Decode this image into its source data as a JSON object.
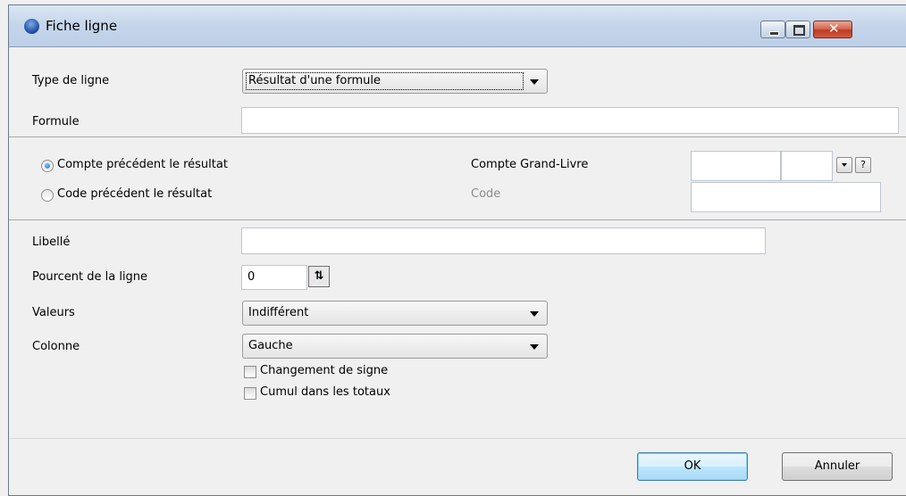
{
  "window": {
    "title": "Fiche ligne",
    "icon": "app-globe-icon"
  },
  "form": {
    "type_ligne_label": "Type de ligne",
    "type_ligne_value": "Résultat d'une formule",
    "formule_label": "Formule",
    "formule_value": "",
    "libelle_label": "Libellé",
    "libelle_value": "",
    "pourcent_label": "Pourcent de la ligne",
    "pourcent_value": "0",
    "valeurs_label": "Valeurs",
    "valeurs_value": "Indifférent",
    "colonne_label": "Colonne",
    "colonne_value": "Gauche",
    "changement_signe_label": "Changement de signe",
    "changement_signe_checked": false,
    "cumul_totaux_label": "Cumul dans les totaux",
    "cumul_totaux_checked": false
  },
  "group": {
    "radio_compte_label": "Compte précédent le résultat",
    "radio_compte_selected": true,
    "radio_code_label": "Code précédent le résultat",
    "radio_code_selected": false,
    "compte_gl_label": "Compte Grand-Livre",
    "compte_gl_value": "",
    "compte_gl_value2": "",
    "code_label": "Code",
    "code_value": "",
    "help_button_label": "?"
  },
  "buttons": {
    "ok_label": "OK",
    "annuler_label": "Annuler"
  },
  "colors": {
    "titlebar": "#c4d5ea",
    "close_button": "#c03a22",
    "disabled_text": "#8d8d8d"
  }
}
